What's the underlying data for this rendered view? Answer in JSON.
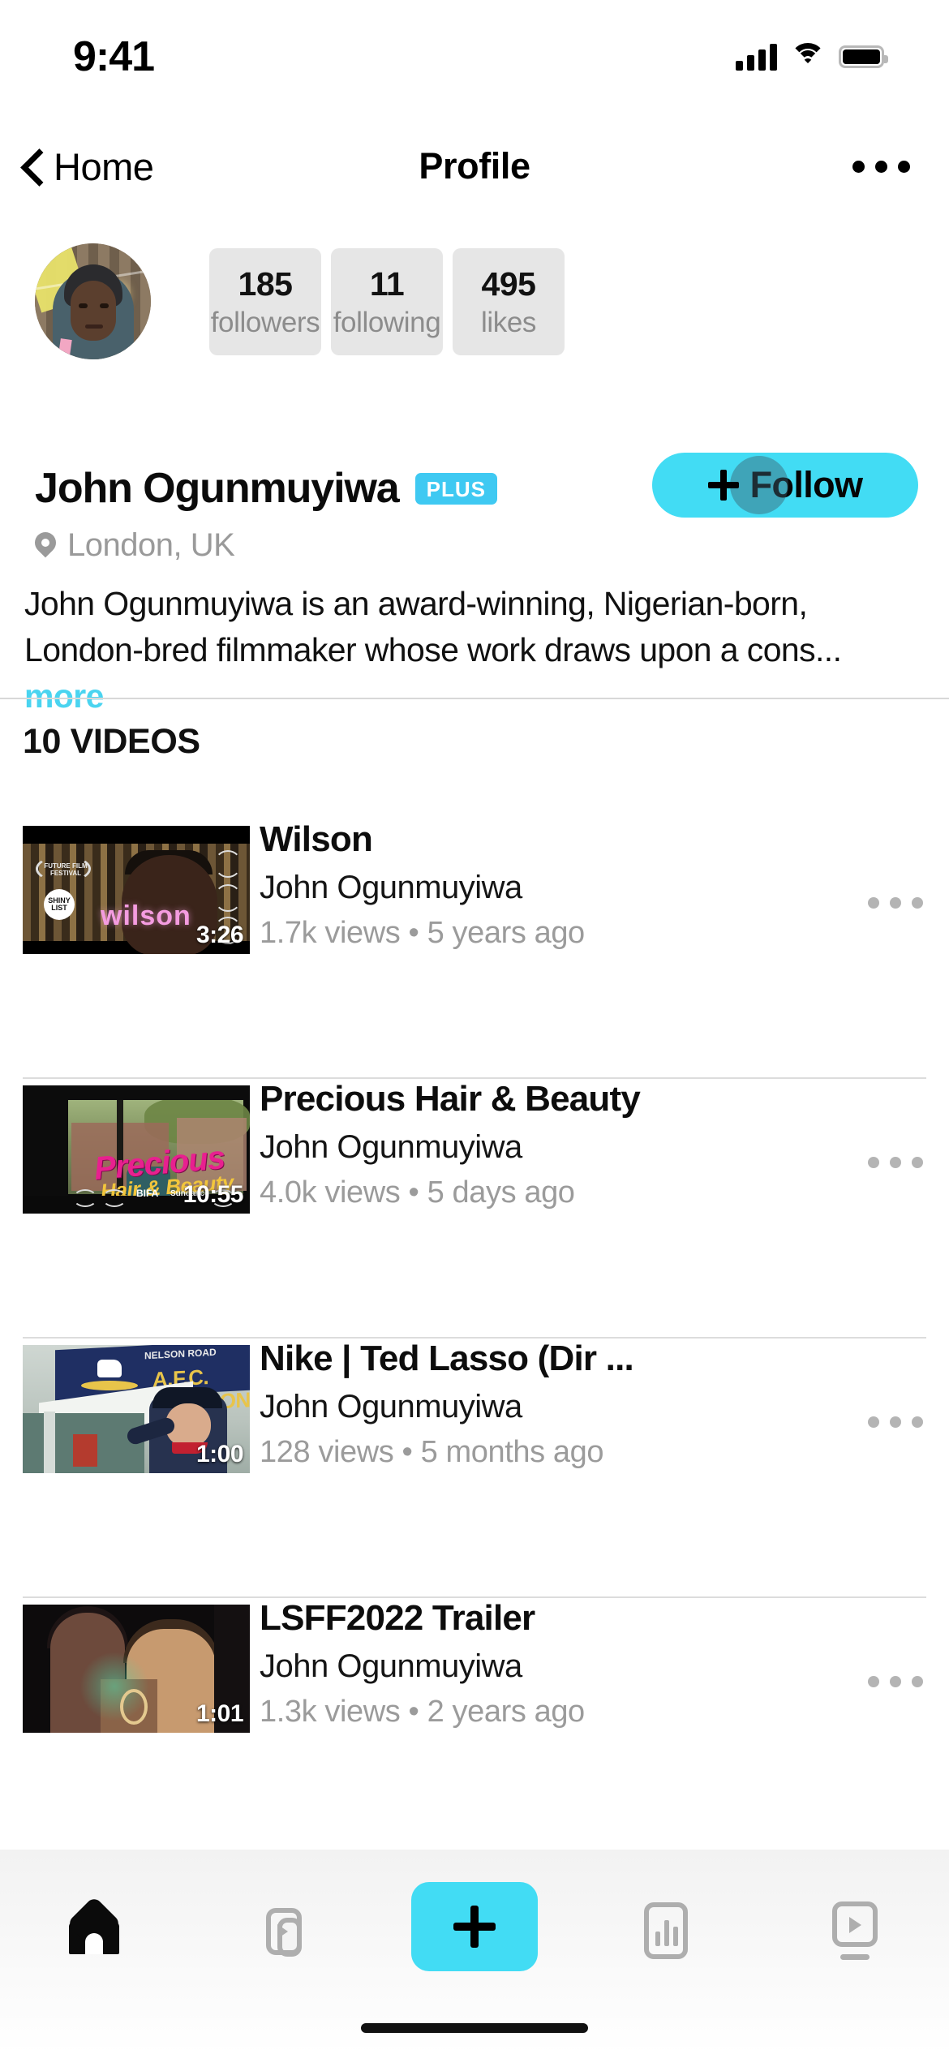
{
  "status_bar": {
    "time": "9:41",
    "icons": [
      "cellular-signal-icon",
      "wifi-icon",
      "battery-icon"
    ]
  },
  "nav": {
    "back_label": "Home",
    "title": "Profile",
    "more_label": "•••"
  },
  "profile": {
    "avatar_alt": "John Ogunmuyiwa profile photo",
    "name": "John Ogunmuyiwa",
    "badge": "PLUS",
    "location": "London, UK",
    "bio_line1": "John Ogunmuyiwa is an award-winning, Nigerian-born,",
    "bio_line2": "London-bred filmmaker whose work draws upon a cons...",
    "bio_more": "more",
    "follow_label": "Follow",
    "stats": [
      {
        "value": "185",
        "label": "followers"
      },
      {
        "value": "11",
        "label": "following"
      },
      {
        "value": "495",
        "label": "likes"
      }
    ]
  },
  "videos_section": {
    "heading": "10 VIDEOS",
    "items": [
      {
        "title": "Wilson",
        "author": "John Ogunmuyiwa",
        "stats": "1.7k views • 5 years ago",
        "duration": "3:26",
        "thumb_text": "wilson",
        "thumb_badge1": "FUTURE FILM FESTIVAL",
        "thumb_badge2": "SHINY LIST"
      },
      {
        "title": "Precious Hair & Beauty",
        "author": "John Ogunmuyiwa",
        "stats": "4.0k views • 5 days ago",
        "duration": "10:55",
        "thumb_text": "Precious",
        "thumb_text2": "Hair & Beauty",
        "thumb_badge1": "BIFA",
        "thumb_badge2": "Sundance"
      },
      {
        "title": "Nike | Ted Lasso (Dir ...",
        "author": "John Ogunmuyiwa",
        "stats": "128 views • 5 months ago",
        "duration": "1:00",
        "thumb_text": "A.F.C. RICHMOND",
        "thumb_text2": "NELSON ROAD"
      },
      {
        "title": "LSFF2022 Trailer",
        "author": "John Ogunmuyiwa",
        "stats": "1.3k views • 2 years ago",
        "duration": "1:01",
        "thumb_text": ""
      }
    ]
  },
  "tabbar": {
    "items": [
      {
        "name": "home",
        "active": true
      },
      {
        "name": "library",
        "active": false
      },
      {
        "name": "create",
        "active": false
      },
      {
        "name": "stats",
        "active": false
      },
      {
        "name": "watch",
        "active": false
      }
    ]
  },
  "colors": {
    "accent": "#42dcf4",
    "badge": "#3fc9f2",
    "muted": "#9b9b9b",
    "card": "#e6e6e6"
  }
}
